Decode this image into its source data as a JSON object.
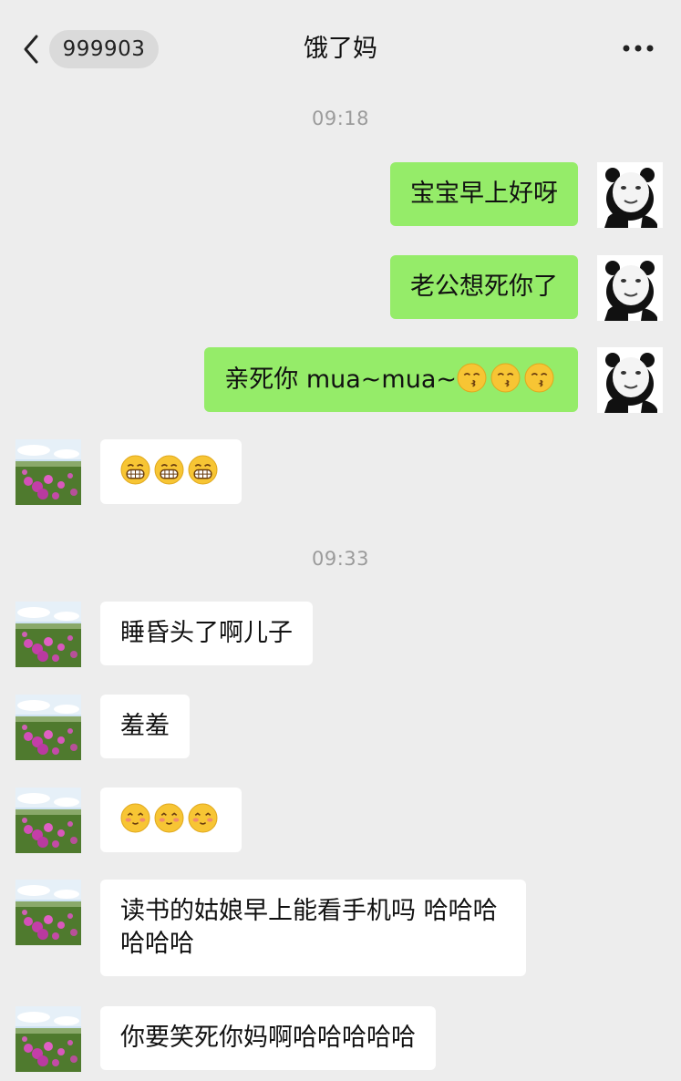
{
  "header": {
    "back_icon": "chevron-left-icon",
    "unread_count": "999903",
    "title": "饿了妈",
    "more_icon": "more-dots-icon"
  },
  "colors": {
    "background": "#ededed",
    "my_bubble": "#95ec69",
    "their_bubble": "#ffffff",
    "timestamp": "#9b9b9b"
  },
  "timestamps": [
    "09:18",
    "09:33"
  ],
  "messages": [
    {
      "sender": "me",
      "avatar": "panda-meme-avatar",
      "text": "宝宝早上好呀"
    },
    {
      "sender": "me",
      "avatar": "panda-meme-avatar",
      "text": "老公想死你了"
    },
    {
      "sender": "me",
      "avatar": "panda-meme-avatar",
      "text": "亲死你 mua~mua~",
      "emojis": [
        "kiss-emoji",
        "kiss-emoji",
        "kiss-emoji"
      ]
    },
    {
      "sender": "them",
      "avatar": "flower-field-avatar",
      "text": "",
      "emojis": [
        "grin-emoji",
        "grin-emoji",
        "grin-emoji"
      ]
    },
    {
      "sender": "them",
      "avatar": "flower-field-avatar",
      "text": "睡昏头了啊儿子"
    },
    {
      "sender": "them",
      "avatar": "flower-field-avatar",
      "text": "羞羞"
    },
    {
      "sender": "them",
      "avatar": "flower-field-avatar",
      "text": "",
      "emojis": [
        "shy-emoji",
        "shy-emoji",
        "shy-emoji"
      ]
    },
    {
      "sender": "them",
      "avatar": "flower-field-avatar",
      "text": "读书的姑娘早上能看手机吗 哈哈哈哈哈哈"
    },
    {
      "sender": "them",
      "avatar": "flower-field-avatar",
      "text": "你要笑死你妈啊哈哈哈哈哈"
    }
  ]
}
